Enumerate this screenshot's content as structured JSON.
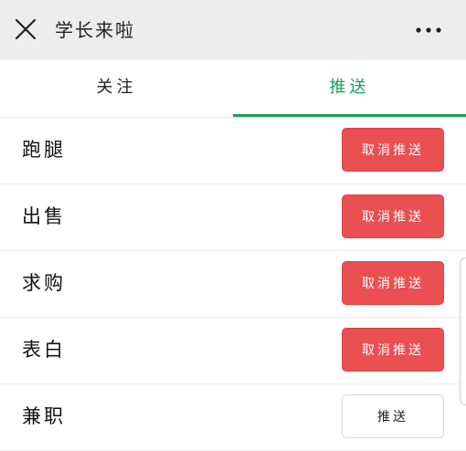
{
  "header": {
    "title": "学长来啦",
    "close_icon": "close-icon",
    "more_icon": "more-icon"
  },
  "tabs": [
    {
      "label": "关注",
      "active": false
    },
    {
      "label": "推送",
      "active": true
    }
  ],
  "items": [
    {
      "label": "跑腿",
      "action": "取消推送",
      "state": "pushed"
    },
    {
      "label": "出售",
      "action": "取消推送",
      "state": "pushed"
    },
    {
      "label": "求购",
      "action": "取消推送",
      "state": "pushed"
    },
    {
      "label": "表白",
      "action": "取消推送",
      "state": "pushed"
    },
    {
      "label": "兼职",
      "action": "推送",
      "state": "not_pushed"
    }
  ],
  "colors": {
    "accent_green": "#1aa05a",
    "cancel_red": "#ea4f52",
    "titlebar_bg": "#ededed"
  }
}
